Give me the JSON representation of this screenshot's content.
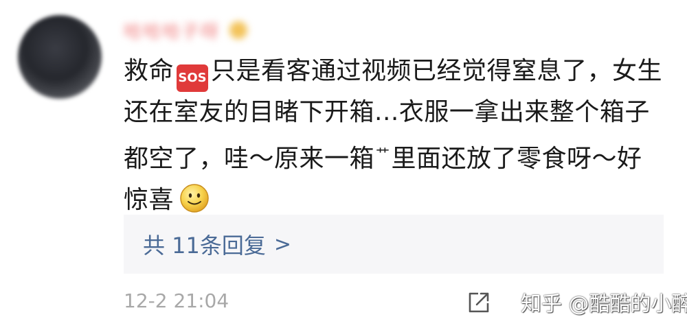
{
  "comment": {
    "username": "哈哈哈子呀",
    "text_part1": "救命",
    "sos_icon": "sos-icon",
    "sos_label": "SOS",
    "text_part2": "只是看客通过视频已经觉得窒息了，女生还在室友的目睹下开箱...衣服一拿出来整个箱子都空了，哇～原来一箱",
    "grass_icon": "grass-icon",
    "grass_label": "艹",
    "text_part3": "里面还放了零食呀～好惊喜",
    "smile_icon": "smiley-face-icon",
    "replies_label": "共 11条回复",
    "replies_chevron": ">",
    "timestamp": "12-2 21:04",
    "share_icon": "share-icon",
    "watermark": "知乎 @酷酷的小醉"
  },
  "colors": {
    "link": "#4a6a96",
    "text": "#1a1a1a",
    "muted": "#a8a8a8",
    "sos": "#e03a3a"
  }
}
